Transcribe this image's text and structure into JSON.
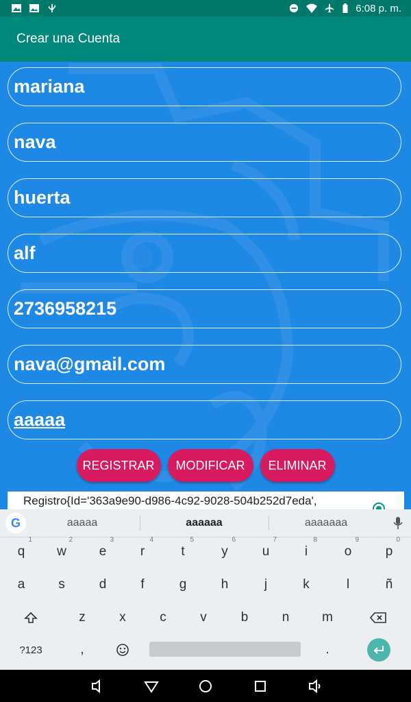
{
  "status_bar": {
    "time": "6:08 p. m.",
    "left_icons": [
      "image-icon",
      "photo-icon",
      "usb-icon"
    ],
    "right_icons": [
      "dnd-icon",
      "wifi-icon",
      "airplane-icon",
      "battery-icon"
    ]
  },
  "app_bar": {
    "title": "Crear una Cuenta"
  },
  "form": {
    "fields": [
      {
        "name": "nombre",
        "value": "mariana"
      },
      {
        "name": "apellido-paterno",
        "value": "nava"
      },
      {
        "name": "apellido-materno",
        "value": "huerta"
      },
      {
        "name": "usuario",
        "value": "alf"
      },
      {
        "name": "telefono",
        "value": "2736958215"
      },
      {
        "name": "correo",
        "value": "nava@gmail.com"
      },
      {
        "name": "password",
        "value": "aaaaa"
      }
    ],
    "buttons": {
      "registrar": "REGISTRAR",
      "modificar": "MODIFICAR",
      "eliminar": "ELIMINAR"
    },
    "record_text": "Registro{Id='363a9e90-d986-4c92-9028-504b252d7eda',"
  },
  "keyboard": {
    "suggestions": [
      "aaaaa",
      "aaaaaa",
      "aaaaaaa"
    ],
    "row1": [
      {
        "k": "q",
        "n": "1"
      },
      {
        "k": "w",
        "n": "2"
      },
      {
        "k": "e",
        "n": "3"
      },
      {
        "k": "r",
        "n": "4"
      },
      {
        "k": "t",
        "n": "5"
      },
      {
        "k": "y",
        "n": "6"
      },
      {
        "k": "u",
        "n": "7"
      },
      {
        "k": "i",
        "n": "8"
      },
      {
        "k": "o",
        "n": "9"
      },
      {
        "k": "p",
        "n": "0"
      }
    ],
    "row2": [
      "a",
      "s",
      "d",
      "f",
      "g",
      "h",
      "j",
      "k",
      "l",
      "ñ"
    ],
    "row3": [
      "z",
      "x",
      "c",
      "v",
      "b",
      "n",
      "m"
    ],
    "symbols_key": "?123",
    "comma_key": ",",
    "period_key": "."
  },
  "colors": {
    "status_bar": "#00796b",
    "app_bar": "#00897b",
    "background": "#1e88e5",
    "button": "#d81b60",
    "enter_key": "#4db6ac"
  }
}
